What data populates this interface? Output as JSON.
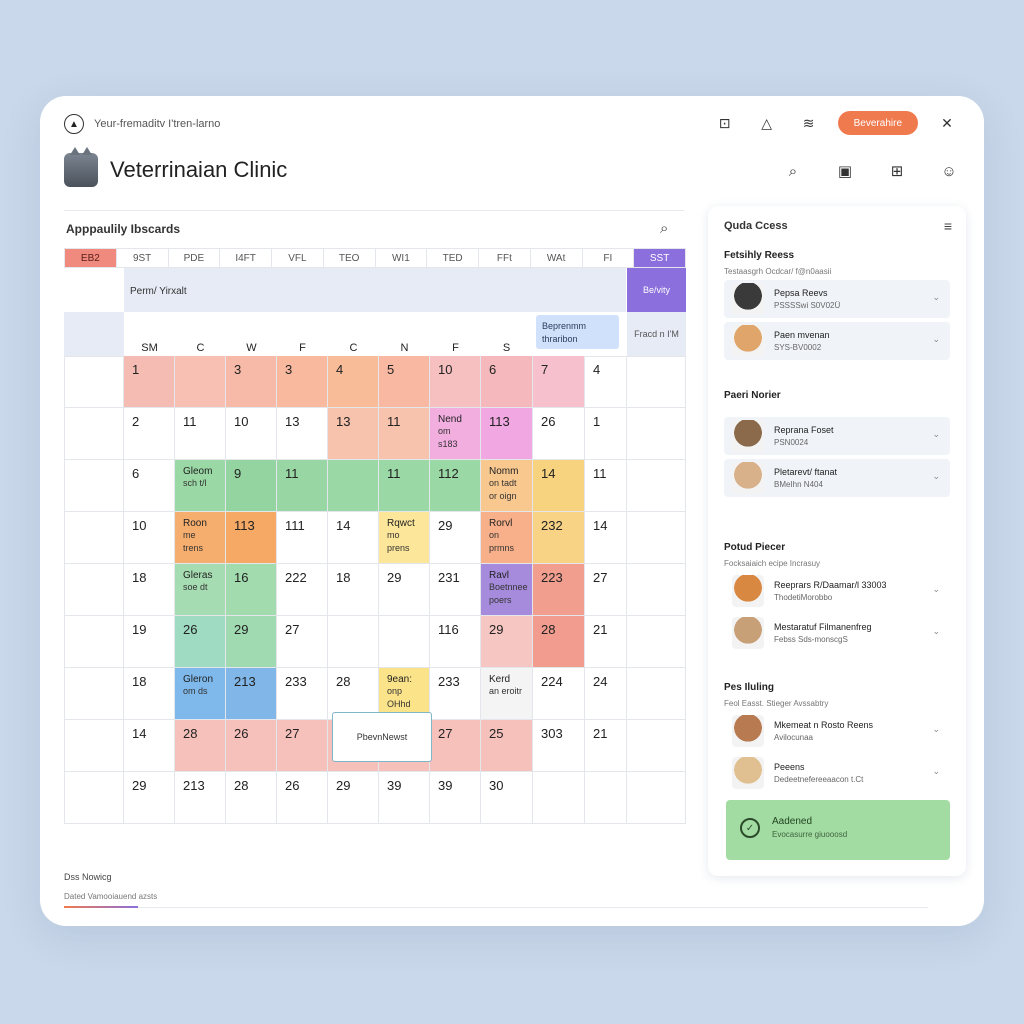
{
  "app": {
    "name": "Yeur-fremaditv I'tren-larno",
    "action_label": "Beverahire"
  },
  "header": {
    "title": "Veterrinaian Clinic"
  },
  "calendar": {
    "title": "Apppaulily Ibscards",
    "columns": [
      "EB2",
      "9ST",
      "PDE",
      "I4FT",
      "VFL",
      "TEO",
      "WI1",
      "TED",
      "FFt",
      "WAt",
      "FI",
      "SST"
    ],
    "band_label": "Perm/ Yirxalt",
    "purple_tag": "Be/vity",
    "floater": [
      "Beprenmm",
      "thraribon"
    ],
    "band3_label": "Fracd n I'M",
    "subheads": [
      "SM",
      "C",
      "W",
      "F",
      "C",
      "N",
      "F",
      "S"
    ],
    "popup": "PbevnNewst",
    "rows": [
      [
        {
          "v": ""
        },
        {
          "v": "1",
          "c": "#f5bcb4"
        },
        {
          "v": "",
          "c": "#f7c0b2"
        },
        {
          "v": "3",
          "c": "#f7b9a8"
        },
        {
          "v": "3",
          "c": "#f8b99e"
        },
        {
          "v": "4",
          "c": "#f9bc99"
        },
        {
          "v": "5",
          "c": "#f8b8a2"
        },
        {
          "v": "10",
          "c": "#f6bfc0"
        },
        {
          "v": "6",
          "c": "#f5b9bd"
        },
        {
          "v": "7",
          "c": "#f6c0cc"
        },
        {
          "v": "4"
        },
        {
          "v": ""
        }
      ],
      [
        {
          "v": ""
        },
        {
          "v": "2"
        },
        {
          "v": "11"
        },
        {
          "v": "10"
        },
        {
          "v": "13"
        },
        {
          "v": "13",
          "c": "#f8c3ad"
        },
        {
          "v": "11",
          "c": "#f8c3ad"
        },
        {
          "v": "Nend",
          "s": "om s183",
          "c": "#f3aee0"
        },
        {
          "v": "113",
          "c": "#f1a8e2"
        },
        {
          "v": "26"
        },
        {
          "v": "1"
        },
        {
          "v": ""
        }
      ],
      [
        {
          "v": ""
        },
        {
          "v": "6"
        },
        {
          "v": "Gleom",
          "s": "sch t/l",
          "c": "#9ad8a5"
        },
        {
          "v": "9",
          "c": "#94d4a0"
        },
        {
          "v": "11",
          "c": "#98d7a3"
        },
        {
          "v": "",
          "c": "#9ad8a5"
        },
        {
          "v": "11",
          "c": "#9ad8a5"
        },
        {
          "v": "112",
          "c": "#9ad8a5"
        },
        {
          "v": "Nomm",
          "s": "on tadt\nor oign",
          "c": "#f8c88f"
        },
        {
          "v": "14",
          "c": "#f8d37f"
        },
        {
          "v": "11"
        },
        {
          "v": ""
        }
      ],
      [
        {
          "v": ""
        },
        {
          "v": "10"
        },
        {
          "v": "Roon",
          "s": "me trens",
          "c": "#f5ae6e"
        },
        {
          "v": "113",
          "c": "#f6a865"
        },
        {
          "v": "111"
        },
        {
          "v": "14"
        },
        {
          "v": "Rqwct",
          "s": "mo prens",
          "c": "#fbe69a"
        },
        {
          "v": "29"
        },
        {
          "v": "Rorvl",
          "s": "on prmns",
          "c": "#f7b08a"
        },
        {
          "v": "232",
          "c": "#f8d386"
        },
        {
          "v": "14"
        },
        {
          "v": ""
        }
      ],
      [
        {
          "v": ""
        },
        {
          "v": "18"
        },
        {
          "v": "Gleras",
          "s": "soe dt",
          "c": "#a6dcb1"
        },
        {
          "v": "16",
          "c": "#a2dcae"
        },
        {
          "v": "222"
        },
        {
          "v": "18"
        },
        {
          "v": "29"
        },
        {
          "v": "231"
        },
        {
          "v": "Ravl",
          "s": "Boetnnee\npoers",
          "c": "#a68bdc"
        },
        {
          "v": "223",
          "c": "#f19e8f"
        },
        {
          "v": "27"
        },
        {
          "v": ""
        }
      ],
      [
        {
          "v": ""
        },
        {
          "v": "19"
        },
        {
          "v": "26",
          "c": "#9fdac2"
        },
        {
          "v": "29",
          "c": "#9fdab0"
        },
        {
          "v": "27"
        },
        {
          "v": ""
        },
        {
          "v": ""
        },
        {
          "v": "116"
        },
        {
          "v": "29",
          "c": "#f6c6c2"
        },
        {
          "v": "28",
          "c": "#f29c8f"
        },
        {
          "v": "21"
        },
        {
          "v": ""
        }
      ],
      [
        {
          "v": ""
        },
        {
          "v": "18"
        },
        {
          "v": "Gleron",
          "s": "om ds",
          "c": "#7fb8ea"
        },
        {
          "v": "213",
          "c": "#80b7e8"
        },
        {
          "v": "233"
        },
        {
          "v": "28"
        },
        {
          "v": "9ean:",
          "s": "onp OHhd",
          "c": "#fbe38a"
        },
        {
          "v": "233"
        },
        {
          "v": "Kerd",
          "s": "an eroitr",
          "c": "#f4f4f4"
        },
        {
          "v": "224"
        },
        {
          "v": "24"
        },
        {
          "v": ""
        }
      ],
      [
        {
          "v": ""
        },
        {
          "v": "14"
        },
        {
          "v": "28",
          "c": "#f6c1bb"
        },
        {
          "v": "26",
          "c": "#f6c1bb"
        },
        {
          "v": "27",
          "c": "#f6c1bb"
        },
        {
          "v": "28",
          "c": "#f6c1bb"
        },
        {
          "v": "28K",
          "c": "#f6c1bb"
        },
        {
          "v": "27",
          "c": "#f6c1bb"
        },
        {
          "v": "25",
          "c": "#f6c1bb"
        },
        {
          "v": "303"
        },
        {
          "v": "21"
        },
        {
          "v": ""
        }
      ],
      [
        {
          "v": ""
        },
        {
          "v": "29"
        },
        {
          "v": "213"
        },
        {
          "v": "28"
        },
        {
          "v": "26"
        },
        {
          "v": "29"
        },
        {
          "v": "39"
        },
        {
          "v": "39"
        },
        {
          "v": "30"
        },
        {
          "v": ""
        },
        {
          "v": ""
        },
        {
          "v": ""
        }
      ]
    ]
  },
  "panel": {
    "title": "Quda Ccess",
    "sections": [
      {
        "title": "Fetsihly Reess",
        "sub": "Testaasgrh Ocdcar/ f@n0aasii",
        "items": [
          {
            "name": "Pepsa Reevs",
            "meta": "PSSSSwi S0V02Ü",
            "pet": "#3a3a3a"
          },
          {
            "name": "Paen mvenan",
            "meta": "SYS-BV0002",
            "pet": "#e0a56a"
          }
        ]
      },
      {
        "title": "Paeri Norier",
        "sub": "",
        "items": [
          {
            "name": "Reprana Foset",
            "meta": "PSN0024",
            "pet": "#8a6a4a"
          },
          {
            "name": "Pletarevt/ ftanat",
            "meta": "BMeIhn N404",
            "pet": "#d8b08a"
          }
        ]
      },
      {
        "title": "Potud Piecer",
        "sub": "Focksaiaich ecipe Incrasuy",
        "items": [
          {
            "name": "Reeprars R/Daamar/l 33003",
            "meta": "ThodetiMorobbo",
            "pet": "#d88840"
          },
          {
            "name": "Mestaratuf Filmanenfreg",
            "meta": "Febss Sds-monscgS",
            "pet": "#c8a078"
          }
        ]
      },
      {
        "title": "Pes Iluling",
        "sub": "Feol Easst. Stieger Avssabtry",
        "items": [
          {
            "name": "Mkemeat n Rosto Reens",
            "meta": "Avilocunaa",
            "pet": "#b87a50"
          },
          {
            "name": "Peeens",
            "meta": "Dedeetnefereeaacon t.Ct",
            "pet": "#e0c090"
          }
        ]
      }
    ],
    "added": {
      "title": "Aadened",
      "sub": "Evocasurre giuooosd"
    }
  },
  "footer": {
    "label": "Dss Nowicg",
    "sub": "Dated Vamooiauend azsts"
  },
  "colors": {
    "accent": "#ef7a4e",
    "purple": "#8b6fdc",
    "success": "#a3dca2"
  }
}
